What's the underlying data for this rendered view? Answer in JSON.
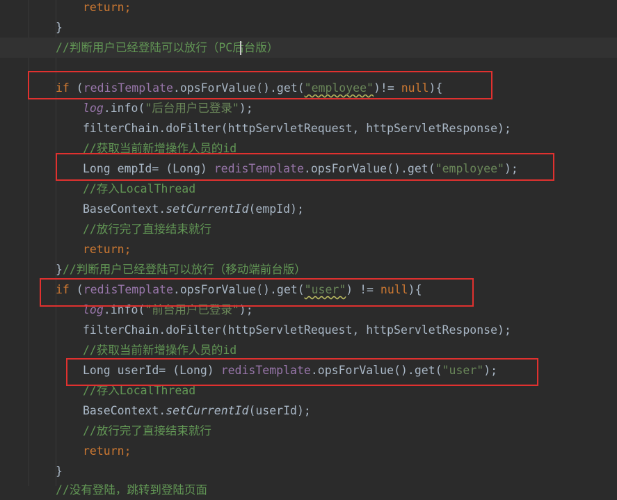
{
  "colors": {
    "background": "#2b2b2b",
    "keyword": "#cc7832",
    "string": "#6a8759",
    "field": "#9876aa",
    "comment": "#629755",
    "default": "#a9b7c6",
    "highlight_box": "#e0312f"
  },
  "code": {
    "l01_return": "return;",
    "l02_brace": "}",
    "l03_comment": "//判断用户已经登陆可以放行（PC后台版）",
    "l05_if": "if",
    "l05_field": "redisTemplate",
    "l05_call": ".opsForValue().get(",
    "l05_str": "\"employee\"",
    "l05_op": ")!= ",
    "l05_null": "null",
    "l05_end": "){",
    "l06_log": "log",
    "l06_info": ".info(",
    "l06_str": "\"后台用户已登录\"",
    "l06_end": ");",
    "l07": "filterChain.doFilter(httpServletRequest, httpServletResponse);",
    "l08_comment": "//获取当前新增操作人员的id",
    "l09_pre": "Long empId= (Long) ",
    "l09_field": "redisTemplate",
    "l09_call": ".opsForValue().get(",
    "l09_str": "\"employee\"",
    "l09_end": ");",
    "l10_comment": "//存入LocalThread",
    "l11_pre": "BaseContext.",
    "l11_method": "setCurrentId",
    "l11_end": "(empId);",
    "l12_comment": "//放行完了直接结束就行",
    "l13_return": "return;",
    "l14_brace": "}",
    "l14_comment": "//判断用户已经登陆可以放行（移动端前台版）",
    "l15_if": "if",
    "l15_field": "redisTemplate",
    "l15_call": ".opsForValue().get(",
    "l15_str": "\"user\"",
    "l15_op": ") != ",
    "l15_null": "null",
    "l15_end": "){",
    "l16_log": "log",
    "l16_info": ".info(",
    "l16_str": "\"前台用户已登录\"",
    "l16_end": ");",
    "l17": "filterChain.doFilter(httpServletRequest, httpServletResponse);",
    "l18_comment": "//获取当前新增操作人员的id",
    "l19_pre": "Long userId= (Long) ",
    "l19_field": "redisTemplate",
    "l19_call": ".opsForValue().get(",
    "l19_str": "\"user\"",
    "l19_end": ");",
    "l20_comment": "//存入LocalThread",
    "l21_pre": "BaseContext.",
    "l21_method": "setCurrentId",
    "l21_end": "(userId);",
    "l22_comment": "//放行完了直接结束就行",
    "l23_return": "return;",
    "l24_brace": "}",
    "l25_comment": "//没有登陆，跳转到登陆页面"
  }
}
